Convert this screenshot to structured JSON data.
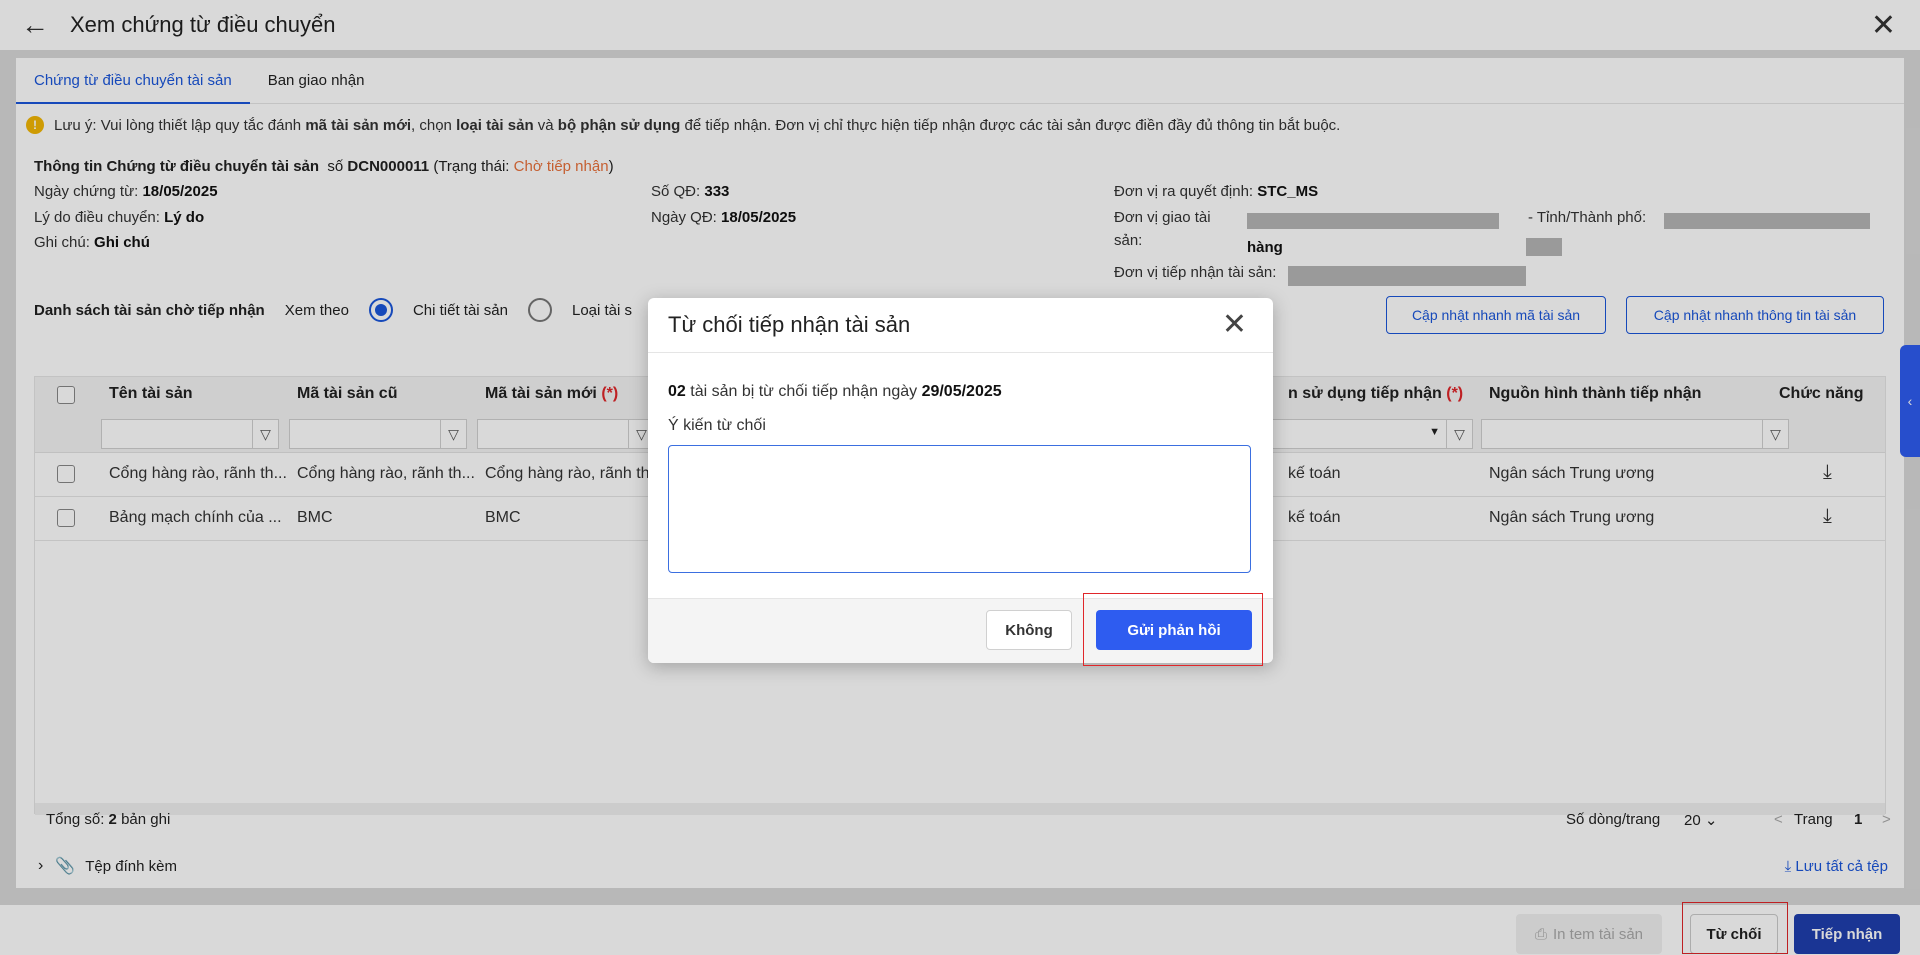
{
  "header": {
    "title": "Xem chứng từ điều chuyển"
  },
  "tabs": [
    "Chứng từ điều chuyển tài sản",
    "Ban giao nhận"
  ],
  "note": {
    "prefix": "Lưu ý: Vui lòng thiết lập quy tắc đánh",
    "b1": "mã tài sản mới",
    "t2": ", chọn",
    "b2": "loại tài sản",
    "t3": "và",
    "b3": "bộ phận sử dụng",
    "t4": "để tiếp nhận. Đơn vị chỉ thực hiện tiếp nhận được các tài sản được điền đầy đủ thông tin bắt buộc."
  },
  "info": {
    "head_label": "Thông tin Chứng từ điều chuyển tài sản",
    "so_label": "số",
    "so_value": "DCN000011",
    "status_prefix": "(Trạng thái:",
    "status_value": "Chờ tiếp nhận",
    "status_suffix": ")",
    "ngay_ct_label": "Ngày chứng từ:",
    "ngay_ct_value": "18/05/2025",
    "ly_do_label": "Lý do điều chuyển:",
    "ly_do_value": "Lý do",
    "ghi_chu_label": "Ghi chú:",
    "ghi_chu_value": "Ghi chú",
    "so_qd_label": "Số QĐ:",
    "so_qd_value": "333",
    "ngay_qd_label": "Ngày QĐ:",
    "ngay_qd_value": "18/05/2025",
    "dv_qd_label": "Đơn vị ra quyết định:",
    "dv_qd_value": "STC_MS",
    "dv_giao_label_1": "Đơn vị giao tài",
    "dv_giao_label_2": "sản:",
    "dv_giao_value": "hàng",
    "tinh_label": "- Tỉnh/Thành phố:",
    "dv_nhan_label": "Đơn vị tiếp nhận tài sản:"
  },
  "list": {
    "label": "Danh sách tài sản chờ tiếp nhận",
    "view_by": "Xem theo",
    "opt1": "Chi tiết tài sản",
    "opt2": "Loại tài s",
    "btn_update_code": "Cập nhật nhanh mã tài sản",
    "btn_update_info": "Cập nhật nhanh thông tin tài sản"
  },
  "grid": {
    "cols": {
      "name": "Tên tài sản",
      "old_code": "Mã tài sản cũ",
      "new_code": "Mã tài sản mới",
      "dept": "n sử dụng tiếp nhận",
      "source": "Nguồn hình thành tiếp nhận",
      "action": "Chức năng"
    },
    "req_mark": "(*)",
    "rows": [
      {
        "name": "Cổng hàng rào, rãnh th...",
        "old": "Cổng hàng rào, rãnh th...",
        "new": "Cổng hàng rào, rãnh th",
        "dept": "kế toán",
        "source": "Ngân sách Trung ương"
      },
      {
        "name": "Bảng mạch chính của ...",
        "old": "BMC",
        "new": "BMC",
        "dept": "kế toán",
        "source": "Ngân sách Trung ương"
      }
    ]
  },
  "pager": {
    "total_label": "Tổng số:",
    "total_value": "2",
    "total_unit": "bản ghi",
    "rows_label": "Số dòng/trang",
    "rows_value": "20",
    "page_label": "Trang",
    "page_value": "1"
  },
  "attach": {
    "label": "Tệp đính kèm",
    "save_all": "Lưu tất cả tệp"
  },
  "bottom": {
    "print": "In tem tài sản",
    "reject": "Từ chối",
    "accept": "Tiếp nhận"
  },
  "modal": {
    "title": "Từ chối tiếp nhận tài sản",
    "count": "02",
    "line_mid": "tài sản bị từ chối tiếp nhận ngày",
    "date": "29/05/2025",
    "comment_label": "Ý kiến từ chối",
    "comment_value": "",
    "btn_no": "Không",
    "btn_send": "Gửi phản hồi"
  },
  "colors": {
    "primary": "#2e5cf0",
    "warn": "#e8703a",
    "required": "#e0262a"
  }
}
